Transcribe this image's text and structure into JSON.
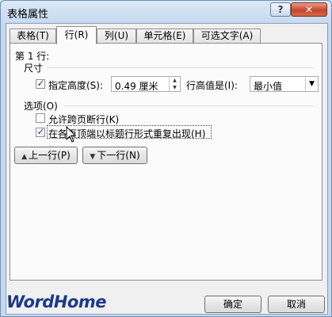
{
  "window": {
    "title": "表格属性"
  },
  "tabs": [
    {
      "label": "表格(T)"
    },
    {
      "label": "行(R)"
    },
    {
      "label": "列(U)"
    },
    {
      "label": "单元格(E)"
    },
    {
      "label": "可选文字(A)"
    }
  ],
  "row_panel": {
    "row_label": "第 1 行:",
    "size_group": "尺寸",
    "specify_height": {
      "label": "指定高度(S):",
      "checked": true
    },
    "height_value": "0.49 厘米",
    "row_height_is_label": "行高值是(I):",
    "row_height_mode": "最小值",
    "options_group": "选项(O)",
    "allow_break": {
      "label": "允许跨页断行(K)",
      "checked": false
    },
    "repeat_header": {
      "label": "在各页顶端以标题行形式重复出现(H)",
      "checked": true
    },
    "prev_row_button": "上一行(P)",
    "next_row_button": "下一行(N)"
  },
  "footer": {
    "watermark": "WordHome",
    "ok_button": "确定",
    "cancel_button": "取消"
  },
  "colors": {
    "accent": "#1b3a8c",
    "close": "#c7442b",
    "watermark": "#1c3a8a"
  },
  "icons": [
    "help-icon",
    "close-icon",
    "checkmark-icon",
    "spinner-icon",
    "dropdown-arrow-icon",
    "up-triangle-icon",
    "down-triangle-icon",
    "mouse-cursor-icon"
  ]
}
